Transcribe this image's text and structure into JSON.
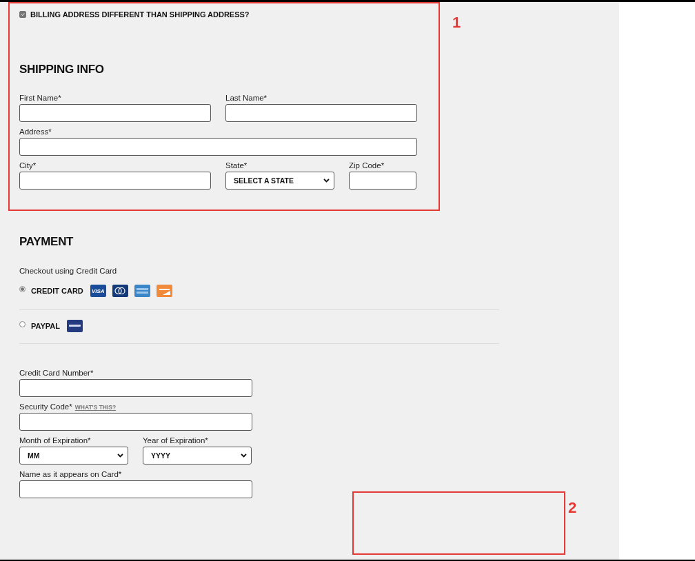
{
  "billing_checkbox": {
    "label": "BILLING ADDRESS DIFFERENT THAN SHIPPING ADDRESS?",
    "checked": true
  },
  "shipping_info": {
    "title": "SHIPPING INFO",
    "rows": [
      [
        {
          "label": "First Name*",
          "kind": "text"
        },
        {
          "label": "Last Name*",
          "kind": "text"
        }
      ],
      [
        {
          "label": "Address*",
          "kind": "text"
        }
      ],
      [
        {
          "label": "City*",
          "kind": "text"
        },
        {
          "label": "State*",
          "kind": "select",
          "value": "SELECT A STATE"
        },
        {
          "label": "Zip Code*",
          "kind": "text"
        }
      ]
    ]
  },
  "payment": {
    "title": "PAYMENT",
    "subtitle": "Checkout using Credit Card",
    "methods": [
      {
        "label": "CREDIT CARD",
        "selected": true,
        "logos": [
          {
            "kind": "visa",
            "label": "VISA"
          },
          {
            "kind": "mastercard"
          },
          {
            "kind": "amex"
          },
          {
            "kind": "discover"
          }
        ]
      },
      {
        "label": "PAYPAL",
        "selected": false,
        "logos": [
          {
            "kind": "paypal"
          }
        ]
      }
    ],
    "rows": [
      [
        {
          "label": "Credit Card Number*",
          "kind": "text"
        }
      ],
      [
        {
          "label": "Security Code*",
          "link": "WHAT'S THIS?",
          "kind": "text"
        }
      ],
      [
        {
          "label": "Month of Expiration*",
          "kind": "select",
          "value": "MM"
        },
        {
          "label": "Year of Expiration*",
          "kind": "select",
          "value": "YYYY"
        }
      ],
      [
        {
          "label": "Name as it appears on Card*",
          "kind": "text"
        }
      ]
    ]
  },
  "annotations": [
    {
      "number": "1"
    },
    {
      "number": "2"
    }
  ]
}
